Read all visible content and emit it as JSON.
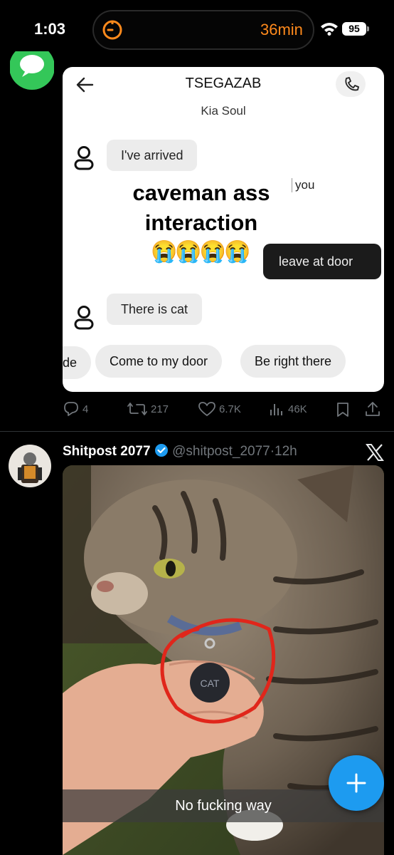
{
  "status_bar": {
    "time": "1:03",
    "timer": "36min",
    "battery": "95"
  },
  "post1": {
    "embedded": {
      "title": "TSEGAZAB",
      "subtitle": "Kia Soul",
      "bubble_incoming_1": "I've arrived",
      "you_label": "you",
      "caption": "caveman ass interaction",
      "emoji": "😭😭😭😭",
      "bubble_outgoing": "leave at door",
      "bubble_incoming_2": "There is cat",
      "chip_partial": "de",
      "chip_1": "Come to my door",
      "chip_2": "Be right there"
    },
    "actions": {
      "replies": "4",
      "reposts": "217",
      "likes": "6.7K",
      "views": "46K"
    }
  },
  "post2": {
    "name": "Shitpost 2077",
    "handle": "@shitpost_2077",
    "separator": "·",
    "time": "12h",
    "image_caption": "No fucking way",
    "tag_text": "CAT"
  },
  "colors": {
    "accent": "#1d9bf0",
    "timer": "#ff8a1c",
    "muted": "#71767b",
    "circle": "#e0261b"
  },
  "icons": [
    "timer-icon",
    "wifi-icon",
    "battery-icon",
    "messages-app-icon",
    "back-arrow-icon",
    "phone-icon",
    "person-icon",
    "reply-icon",
    "repost-icon",
    "like-icon",
    "views-icon",
    "bookmark-icon",
    "share-icon",
    "verified-badge-icon",
    "x-logo-icon",
    "plus-icon"
  ]
}
